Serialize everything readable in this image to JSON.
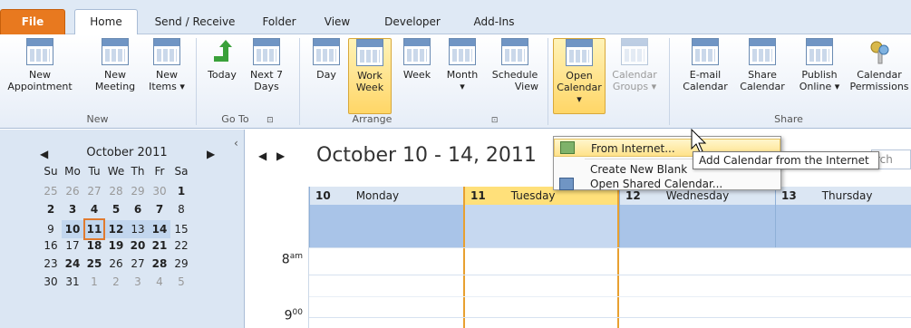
{
  "tabs": [
    "File",
    "Home",
    "Send / Receive",
    "Folder",
    "View",
    "Developer",
    "Add-Ins"
  ],
  "ribbon": {
    "new_appointment": [
      "New",
      "Appointment"
    ],
    "new_meeting": [
      "New",
      "Meeting"
    ],
    "new_items": [
      "New",
      "Items ▾"
    ],
    "today": "Today",
    "next7": [
      "Next 7",
      "Days"
    ],
    "day": "Day",
    "workweek": [
      "Work",
      "Week"
    ],
    "week": "Week",
    "month": [
      "Month",
      "▾"
    ],
    "schedule": [
      "Schedule",
      "View"
    ],
    "open_calendar": [
      "Open",
      "Calendar ▾"
    ],
    "calendar_groups": [
      "Calendar",
      "Groups ▾"
    ],
    "email_calendar": [
      "E-mail",
      "Calendar"
    ],
    "share_calendar": [
      "Share",
      "Calendar"
    ],
    "publish_online": [
      "Publish",
      "Online ▾"
    ],
    "calendar_permissions": [
      "Calendar",
      "Permissions"
    ],
    "groups": {
      "new": "New",
      "goto": "Go To",
      "arrange": "Arrange",
      "share": "Share",
      "launcher": "⊡"
    }
  },
  "mini": {
    "title": "October 2011",
    "dow": [
      "Su",
      "Mo",
      "Tu",
      "We",
      "Th",
      "Fr",
      "Sa"
    ],
    "weeks": [
      [
        "25",
        "26",
        "27",
        "28",
        "29",
        "30",
        "1"
      ],
      [
        "2",
        "3",
        "4",
        "5",
        "6",
        "7",
        "8"
      ],
      [
        "9",
        "10",
        "11",
        "12",
        "13",
        "14",
        "15"
      ],
      [
        "16",
        "17",
        "18",
        "19",
        "20",
        "21",
        "22"
      ],
      [
        "23",
        "24",
        "25",
        "26",
        "27",
        "28",
        "29"
      ],
      [
        "30",
        "31",
        "1",
        "2",
        "3",
        "4",
        "5"
      ]
    ]
  },
  "main": {
    "range": "October 10 - 14, 2011",
    "search": "rch Ca",
    "days": [
      {
        "num": "10",
        "name": "Monday"
      },
      {
        "num": "11",
        "name": "Tuesday"
      },
      {
        "num": "12",
        "name": "Wednesday"
      },
      {
        "num": "13",
        "name": "Thursday"
      }
    ],
    "h8": "8",
    "h9": "9",
    "am": "am",
    "zero": "00"
  },
  "menu": {
    "item1": "From Internet...",
    "item2": "Create New Blank",
    "item3": "Open Shared Calendar..."
  },
  "tooltip": "Add Calendar from the Internet",
  "colors": {
    "accent": "#e8791f",
    "highlight": "#ffd667",
    "daybg": "#a9c4e8"
  }
}
